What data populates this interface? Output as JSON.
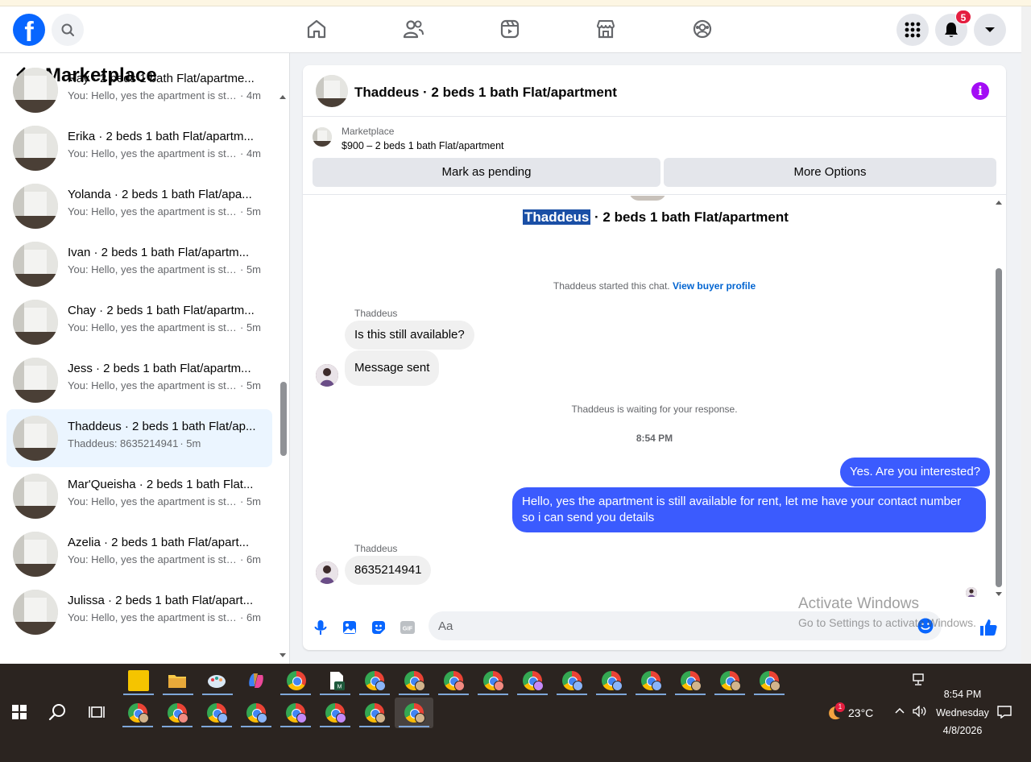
{
  "sidebar": {
    "title": "Marketplace",
    "items": [
      {
        "name": "Ray · 2 beds 1 bath Flat/apartme...",
        "preview": "You: Hello, yes the apartment is stil...",
        "time": "· 4m"
      },
      {
        "name": "Erika · 2 beds 1 bath Flat/apartm...",
        "preview": "You: Hello, yes the apartment is stil...",
        "time": "· 4m"
      },
      {
        "name": "Yolanda · 2 beds 1 bath Flat/apa...",
        "preview": "You: Hello, yes the apartment is stil...",
        "time": "· 5m"
      },
      {
        "name": "Ivan · 2 beds 1 bath Flat/apartm...",
        "preview": "You: Hello, yes the apartment is stil...",
        "time": "· 5m"
      },
      {
        "name": "Chay · 2 beds 1 bath Flat/apartm...",
        "preview": "You: Hello, yes the apartment is stil...",
        "time": "· 5m"
      },
      {
        "name": "Jess · 2 beds 1 bath Flat/apartm...",
        "preview": "You: Hello, yes the apartment is stil...",
        "time": "· 5m"
      },
      {
        "name": "Thaddeus · 2 beds 1 bath Flat/ap...",
        "preview": "Thaddeus: 8635214941",
        "time": "· 5m"
      },
      {
        "name": "Mar'Queisha · 2 beds 1 bath Flat...",
        "preview": "You: Hello, yes the apartment is stil...",
        "time": "· 5m"
      },
      {
        "name": "Azelia · 2 beds 1 bath Flat/apart...",
        "preview": "You: Hello, yes the apartment is stil...",
        "time": "· 6m"
      },
      {
        "name": "Julissa · 2 beds 1 bath Flat/apart...",
        "preview": "You: Hello, yes the apartment is stil...",
        "time": "· 6m"
      }
    ]
  },
  "header": {
    "notification_count": "5",
    "icons": [
      "home-icon",
      "friends-icon",
      "video-icon",
      "marketplace-icon",
      "groups-icon",
      "menu-grid-icon",
      "bell-icon",
      "account-chevron-icon"
    ]
  },
  "chat": {
    "title": "Thaddeus · 2 beds 1 bath Flat/apartment",
    "listing_category": "Marketplace",
    "listing_price": "$900 – 2 beds 1 bath Flat/apartment",
    "btn_pending": "Mark as pending",
    "btn_more": "More Options",
    "convo_name": "Thaddeus",
    "convo_rest": " · 2 beds 1 bath Flat/apartment",
    "started_text": "Thaddeus started this chat. ",
    "started_link": "View buyer profile",
    "sender1": "Thaddeus",
    "msg1": "Is this still available?",
    "msg2": "Message sent",
    "waiting": "Thaddeus is waiting for your response.",
    "timestamp": "8:54 PM",
    "out1": "Yes. Are you interested?",
    "out2": "Hello, yes the apartment is still available for rent, let me have your contact number so i can send you details",
    "sender2": "Thaddeus",
    "msg3": "8635214941",
    "composer_placeholder": "Aa"
  },
  "watermark": {
    "line1": "Activate Windows",
    "line2": "Go to Settings to activate Windows."
  },
  "taskbar": {
    "weather_temp": "23°C",
    "weather_badge": "1",
    "time": "8:54 PM",
    "day": "Wednesday",
    "date": "4/8/2026"
  },
  "colors": {
    "brand": "#0866ff",
    "outgoing_bubble": "#3b5bfe",
    "info_icon": "#a30cf5",
    "badge": "#e41e3f"
  }
}
